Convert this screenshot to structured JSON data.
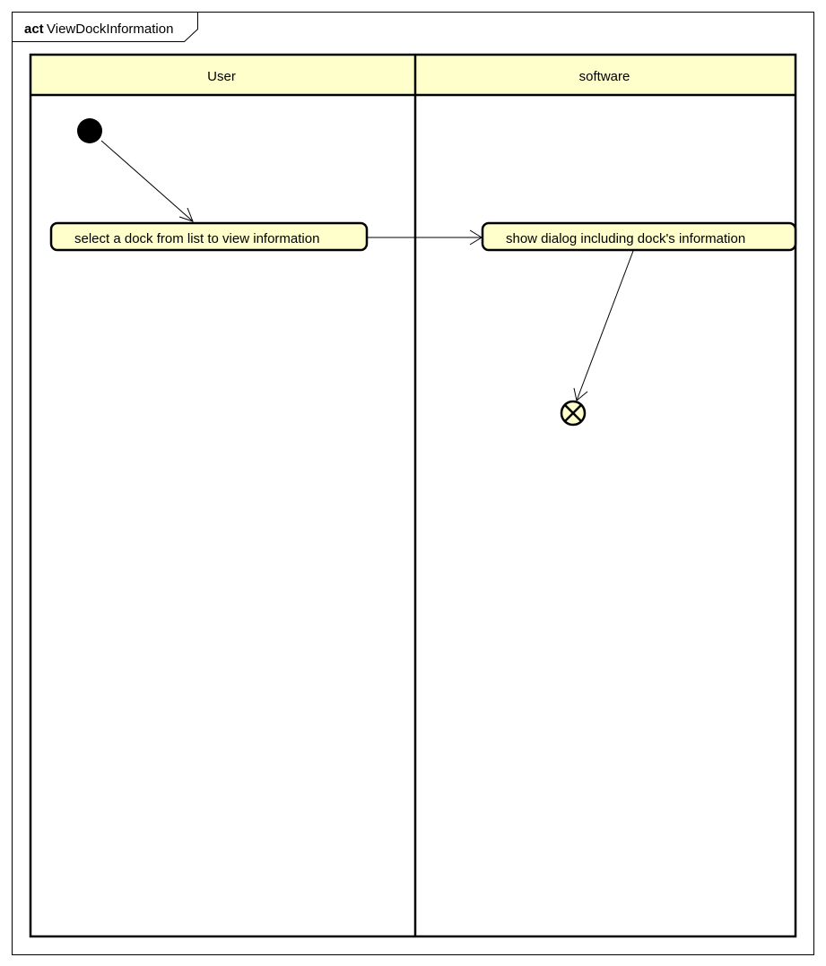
{
  "diagram": {
    "kind_keyword": "act",
    "name": "ViewDockInformation",
    "colors": {
      "lane_header_fill": "#FFFFCC",
      "action_fill": "#FFFFCC",
      "line": "#000000",
      "background": "#FFFFFF"
    },
    "lanes": [
      {
        "label": "User"
      },
      {
        "label": "software"
      }
    ],
    "actions": [
      {
        "label": "select a dock from list to view information",
        "lane": "User"
      },
      {
        "label": "show dialog including dock's information",
        "lane": "software"
      }
    ],
    "nodes": {
      "initial": "initial-node",
      "final": "flow-final-node"
    },
    "flows": [
      {
        "from": "initial-node",
        "to": "select a dock from list to view information"
      },
      {
        "from": "select a dock from list to view information",
        "to": "show dialog including dock's information"
      },
      {
        "from": "show dialog including dock's information",
        "to": "flow-final-node"
      }
    ]
  }
}
